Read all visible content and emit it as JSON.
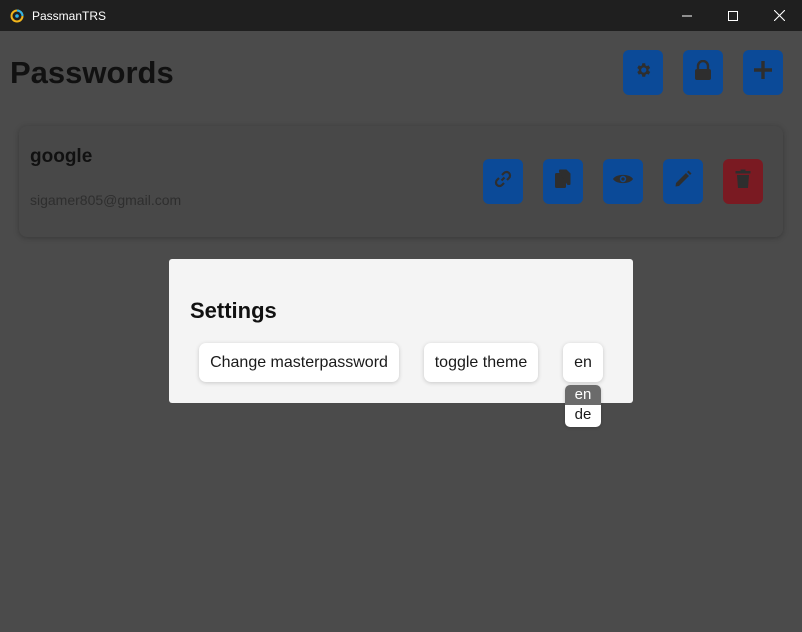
{
  "window": {
    "title": "PassmanTRS",
    "controls": [
      "minimize-icon",
      "maximize-icon",
      "close-icon"
    ]
  },
  "header": {
    "title": "Passwords",
    "buttons": [
      {
        "name": "settings",
        "icon": "gear-icon"
      },
      {
        "name": "lock",
        "icon": "lock-icon"
      },
      {
        "name": "add",
        "icon": "plus-icon"
      }
    ]
  },
  "entries": [
    {
      "title": "google",
      "username": "sigamer805@gmail.com",
      "actions": [
        "link-icon",
        "copy-icon",
        "eye-icon",
        "pencil-icon",
        "trash-icon"
      ]
    }
  ],
  "settings_modal": {
    "title": "Settings",
    "change_master_label": "Change masterpassword",
    "toggle_theme_label": "toggle theme",
    "language_selected": "en",
    "language_options": [
      "en",
      "de"
    ]
  },
  "colors": {
    "titlebar": "#1f1f1f",
    "background": "#4b4b4b",
    "primary_button": "#0b4a98",
    "danger_button": "#7a1a22",
    "modal": "#f4f4f4"
  }
}
